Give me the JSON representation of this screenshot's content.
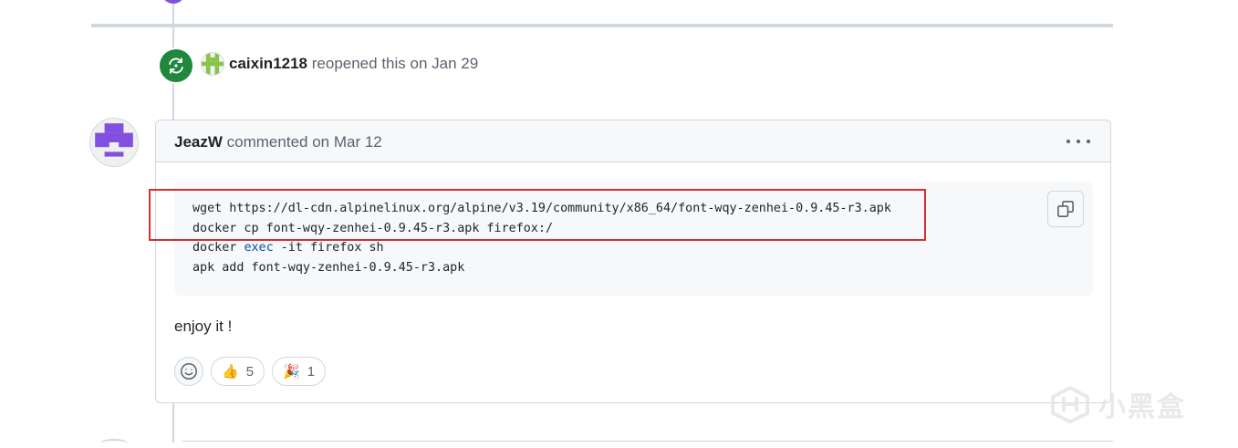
{
  "timeline_event": {
    "author": "caixin1218",
    "action": "reopened this",
    "date_text": "on Jan 29"
  },
  "comment": {
    "author": "JeazW",
    "action": "commented",
    "date_text": "on Mar 12",
    "code": {
      "line1": "wget https://dl-cdn.alpinelinux.org/alpine/v3.19/community/x86_64/font-wqy-zenhei-0.9.45-r3.apk",
      "line2": "docker cp font-wqy-zenhei-0.9.45-r3.apk firefox:/",
      "line3_cmd": "docker ",
      "line3_kw": "exec",
      "line3_rest": " -it firefox sh",
      "line4": "apk add font-wqy-zenhei-0.9.45-r3.apk"
    },
    "body": "enjoy it !",
    "reactions": [
      {
        "emoji": "👍",
        "count": "5"
      },
      {
        "emoji": "🎉",
        "count": "1"
      }
    ]
  },
  "watermark": {
    "text": "小黑盒"
  },
  "colors": {
    "reopen_green": "#1f883d",
    "highlight_red": "#d32f2f",
    "avatar_purple": "#8250df",
    "identicon_green": "#8bc34a"
  },
  "icons": {
    "reopen": "reopen-icon",
    "kebab": "kebab-horizontal-icon",
    "copy": "copy-icon",
    "add_reaction": "smiley-icon"
  }
}
